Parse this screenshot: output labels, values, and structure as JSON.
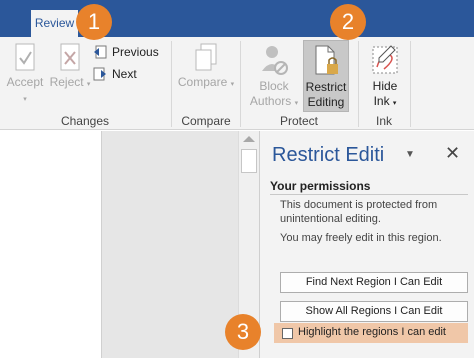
{
  "tabs": {
    "review": "Review"
  },
  "ribbon": {
    "changes": {
      "accept": "Accept",
      "reject": "Reject",
      "previous": "Previous",
      "next": "Next",
      "group_label": "Changes"
    },
    "compare": {
      "compare": "Compare",
      "group_label": "Compare"
    },
    "protect": {
      "block_line1": "Block",
      "block_line2": "Authors",
      "restrict_line1": "Restrict",
      "restrict_line2": "Editing",
      "group_label": "Protect"
    },
    "ink": {
      "hide_line1": "Hide",
      "hide_line2": "Ink",
      "group_label": "Ink"
    }
  },
  "pane": {
    "title": "Restrict Editi",
    "permissions_header": "Your permissions",
    "protected_line1": "This document is protected from",
    "protected_line2": "unintentional editing.",
    "freely_edit": "You may freely edit in this region.",
    "find_next_button": "Find Next Region I Can Edit",
    "show_all_button": "Show All Regions I Can Edit",
    "highlight_label": "Highlight the regions I can edit",
    "highlight_checked": false
  },
  "callouts": [
    "1",
    "2",
    "3"
  ],
  "colors": {
    "accent_blue": "#2b579a",
    "callout_orange": "#e8822b",
    "highlight_row": "#f0c7a8"
  }
}
